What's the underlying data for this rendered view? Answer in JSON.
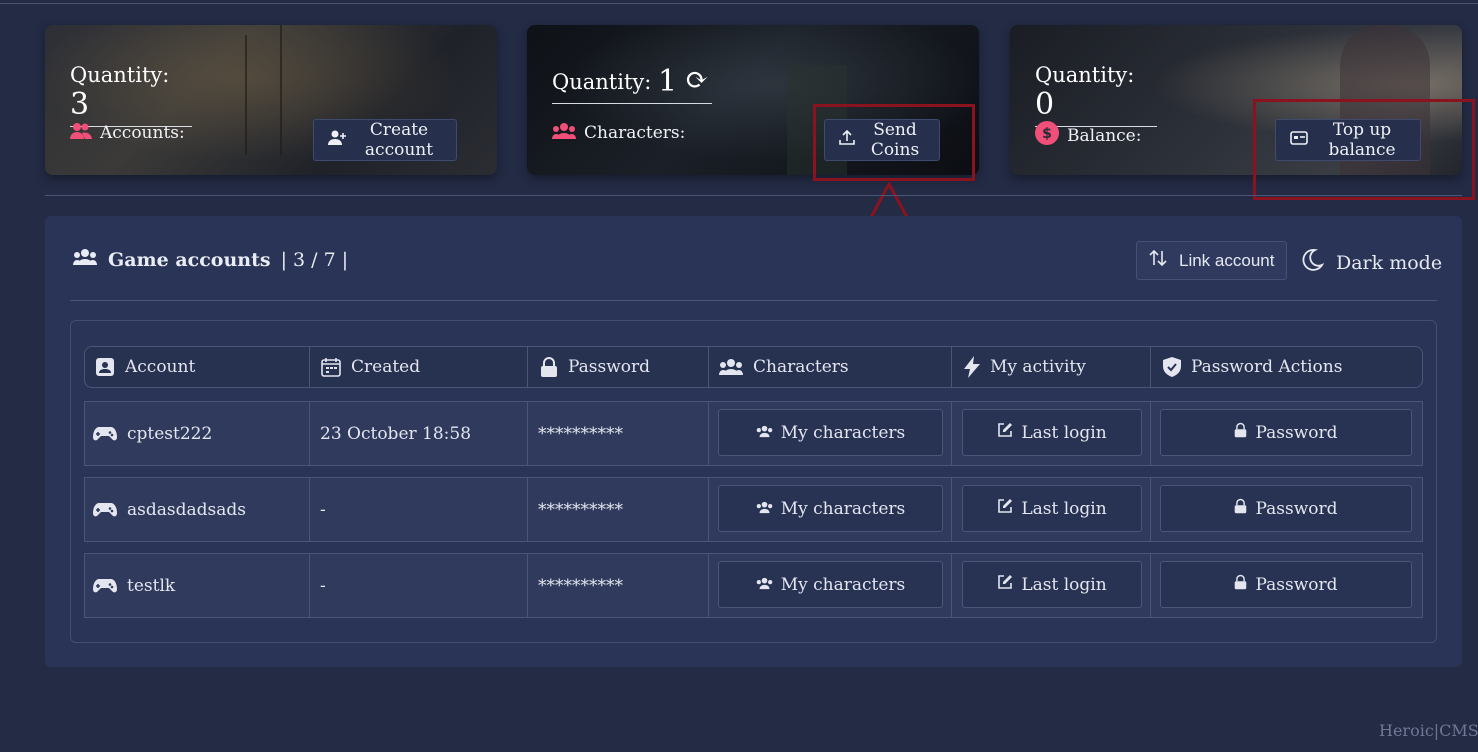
{
  "stats": {
    "accounts": {
      "label": "Quantity:",
      "value": "3",
      "sub": "Accounts:",
      "button": "Create account"
    },
    "characters": {
      "label": "Quantity:",
      "value": "1",
      "sub": "Characters:",
      "button": "Send Coins"
    },
    "balance": {
      "label": "Quantity:",
      "value": "0",
      "sub": "Balance:",
      "button": "Top up balance"
    }
  },
  "panel": {
    "title": "Game accounts",
    "count": "| 3 / 7 |",
    "link_button": "Link account",
    "dark_mode": "Dark mode"
  },
  "table": {
    "headers": [
      "Account",
      "Created",
      "Password",
      "Characters",
      "My activity",
      "Password Actions"
    ],
    "rows": [
      {
        "account": "cptest222",
        "created": "23 October 18:58",
        "password": "**********",
        "characters_btn": "My characters",
        "activity_btn": "Last login",
        "password_btn": "Password"
      },
      {
        "account": "asdasdadsads",
        "created": "-",
        "password": "**********",
        "characters_btn": "My characters",
        "activity_btn": "Last login",
        "password_btn": "Password"
      },
      {
        "account": "testlk",
        "created": "-",
        "password": "**********",
        "characters_btn": "My characters",
        "activity_btn": "Last login",
        "password_btn": "Password"
      }
    ]
  },
  "footer": "Heroic|CMS",
  "colors": {
    "accent_pink": "#ef4f78",
    "highlight_red": "#8b1320",
    "background": "#232b45",
    "panel": "#2a3456"
  }
}
